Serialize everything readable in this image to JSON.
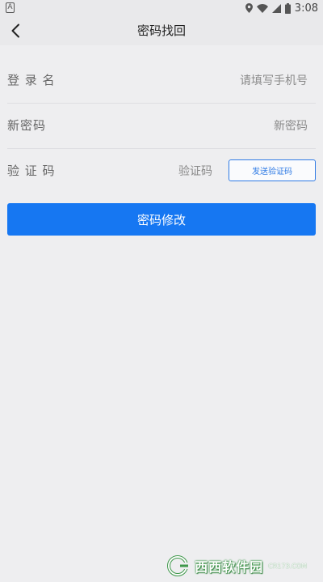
{
  "status_bar": {
    "left_icon": "A",
    "time": "3:08",
    "icons": [
      "location-icon",
      "wifi-icon",
      "signal-icon",
      "battery-icon"
    ]
  },
  "nav": {
    "title": "密码找回",
    "back_icon": "chevron-left-icon"
  },
  "form": {
    "username": {
      "label": "登 录 名",
      "placeholder": "请填写手机号"
    },
    "new_password": {
      "label": "新密码",
      "placeholder": "新密码"
    },
    "code": {
      "label": "验 证 码",
      "placeholder": "验证码",
      "send_label": "发送验证码"
    }
  },
  "submit_label": "密码修改",
  "watermark": {
    "text": "西西软件园",
    "sub": "CR173.COM"
  },
  "colors": {
    "accent": "#1677f2",
    "background": "#eeeef0",
    "header": "#e9e9eb"
  }
}
